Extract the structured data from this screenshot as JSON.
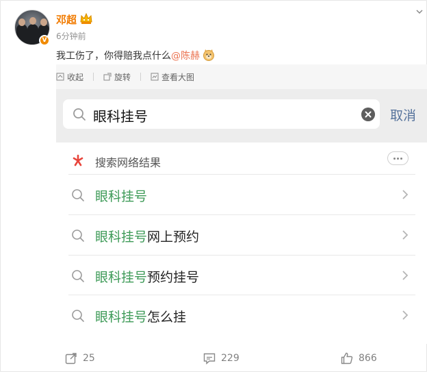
{
  "post": {
    "author": "邓超",
    "time": "6分钟前",
    "text_prefix": "我工伤了，你得赔我点什么",
    "mention": "@陈赫",
    "verified_badge": "V"
  },
  "image_toolbar": {
    "collapse": "收起",
    "rotate": "旋转",
    "view_large": "查看大图"
  },
  "screenshot": {
    "search_query": "眼科挂号",
    "cancel": "取消",
    "results_header": "搜索网络结果",
    "results": [
      {
        "highlight": "眼科挂号",
        "rest": ""
      },
      {
        "highlight": "眼科挂号",
        "rest": "网上预约"
      },
      {
        "highlight": "眼科挂号",
        "rest": "预约挂号"
      },
      {
        "highlight": "眼科挂号",
        "rest": "怎么挂"
      }
    ]
  },
  "footer": {
    "shares": "25",
    "comments": "229",
    "likes": "866"
  },
  "colors": {
    "author": "#f17b00",
    "mention": "#eb7350",
    "highlight": "#3d9a57",
    "cancel": "#56739c"
  }
}
